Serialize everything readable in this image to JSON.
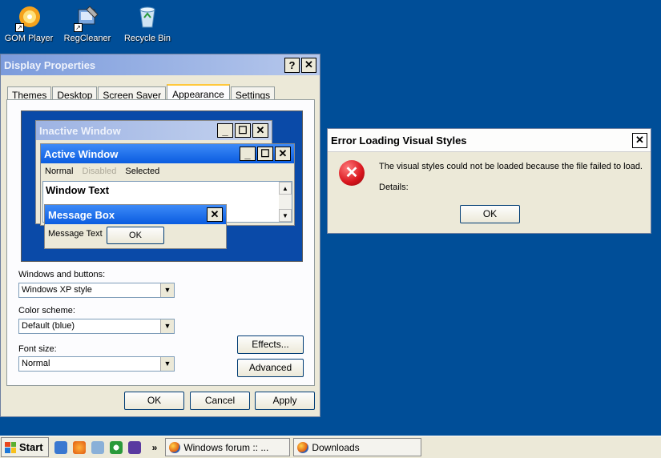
{
  "desktop": {
    "icons": [
      {
        "label": "GOM Player"
      },
      {
        "label": "RegCleaner"
      },
      {
        "label": "Recycle Bin"
      }
    ]
  },
  "display_properties": {
    "title": "Display Properties",
    "help": "?",
    "close": "✕",
    "tabs": [
      {
        "label": "Themes",
        "active": false
      },
      {
        "label": "Desktop",
        "active": false
      },
      {
        "label": "Screen Saver",
        "active": false
      },
      {
        "label": "Appearance",
        "active": true
      },
      {
        "label": "Settings",
        "active": false
      }
    ],
    "preview": {
      "inactive_title": "Inactive Window",
      "active_title": "Active Window",
      "menu_normal": "Normal",
      "menu_disabled": "Disabled",
      "menu_selected": "Selected",
      "window_text": "Window Text",
      "msgbox_title": "Message Box",
      "msgbox_text": "Message Text",
      "msgbox_ok": "OK",
      "minimize": "_",
      "maximize": "☐",
      "close": "✕",
      "scroll_up": "▲",
      "scroll_down": "▼"
    },
    "windows_buttons_label": "Windows and buttons:",
    "windows_buttons_value": "Windows XP style",
    "color_scheme_label": "Color scheme:",
    "color_scheme_value": "Default (blue)",
    "font_size_label": "Font size:",
    "font_size_value": "Normal",
    "dropdown_arrow": "▼",
    "effects_button": "Effects...",
    "advanced_button": "Advanced",
    "ok_button": "OK",
    "cancel_button": "Cancel",
    "apply_button": "Apply"
  },
  "error_dialog": {
    "title": "Error Loading Visual Styles",
    "close": "✕",
    "message": "The visual styles could not be loaded because the file failed to load.",
    "details": "Details:",
    "ok_button": "OK",
    "icon_glyph": "✕"
  },
  "taskbar": {
    "start": "Start",
    "chevron": "»",
    "tasks": [
      {
        "label": "Windows forum :: ..."
      },
      {
        "label": "Downloads"
      }
    ]
  },
  "colors": {
    "desktop": "#004e98",
    "error_icon": "#d8141c",
    "active_title": "#0a5ce0"
  }
}
